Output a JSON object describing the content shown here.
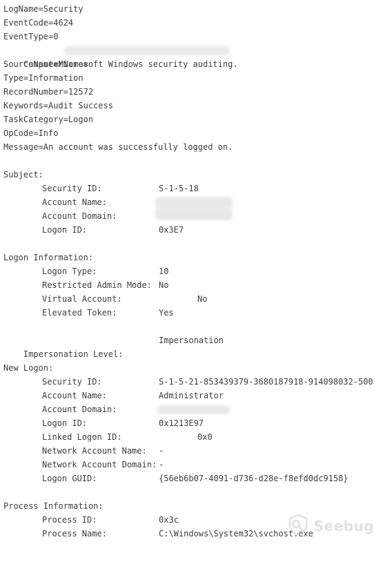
{
  "header": {
    "logname": "LogName=Security",
    "eventcode": "EventCode=4624",
    "eventtype": "EventType=0",
    "computername": "ComputerName=",
    "sourcename": "SourceName=Microsoft Windows security auditing.",
    "type": "Type=Information",
    "recordnumber": "RecordNumber=12572",
    "keywords": "Keywords=Audit Success",
    "taskcategory": "TaskCategory=Logon",
    "opcode": "OpCode=Info",
    "message": "Message=An account was successfully logged on."
  },
  "subject": {
    "title": "Subject:",
    "security_id_label": "Security ID:",
    "security_id_value": "S-1-5-18",
    "account_name_label": "Account Name:",
    "account_domain_label": "Account Domain:",
    "logon_id_label": "Logon ID:",
    "logon_id_value": "0x3E7"
  },
  "logon_info": {
    "title": "Logon Information:",
    "logon_type_label": "Logon Type:",
    "logon_type_value": "10",
    "restricted_label": "Restricted Admin Mode:",
    "restricted_value": "No",
    "virtual_label": "Virtual Account:",
    "virtual_value": "No",
    "elevated_label": "Elevated Token:",
    "elevated_value": "Yes"
  },
  "impersonation": {
    "label": "Impersonation Level:",
    "value": "Impersonation"
  },
  "new_logon": {
    "title": "New Logon:",
    "security_id_label": "Security ID:",
    "security_id_value": "S-1-5-21-853439379-3680187918-914098032-500",
    "account_name_label": "Account Name:",
    "account_name_value": "Administrator",
    "account_domain_label": "Account Domain:",
    "logon_id_label": "Logon ID:",
    "logon_id_value": "0x1213E97",
    "linked_label": "Linked Logon ID:",
    "linked_value": "0x0",
    "net_name_label": "Network Account Name:",
    "net_name_value": "-",
    "net_domain_label": "Network Account Domain:",
    "net_domain_value": "-",
    "guid_label": "Logon GUID:",
    "guid_value": "{56eb6b07-4091-d736-d28e-f8efd0dc9158}"
  },
  "process": {
    "title": "Process Information:",
    "pid_label": "Process ID:",
    "pid_value": "0x3c",
    "pname_label": "Process Name:",
    "pname_value": "C:\\Windows\\System32\\svchost.exe"
  },
  "watermark": {
    "text": "Seebug",
    "icon": "seebug-logo-icon"
  }
}
